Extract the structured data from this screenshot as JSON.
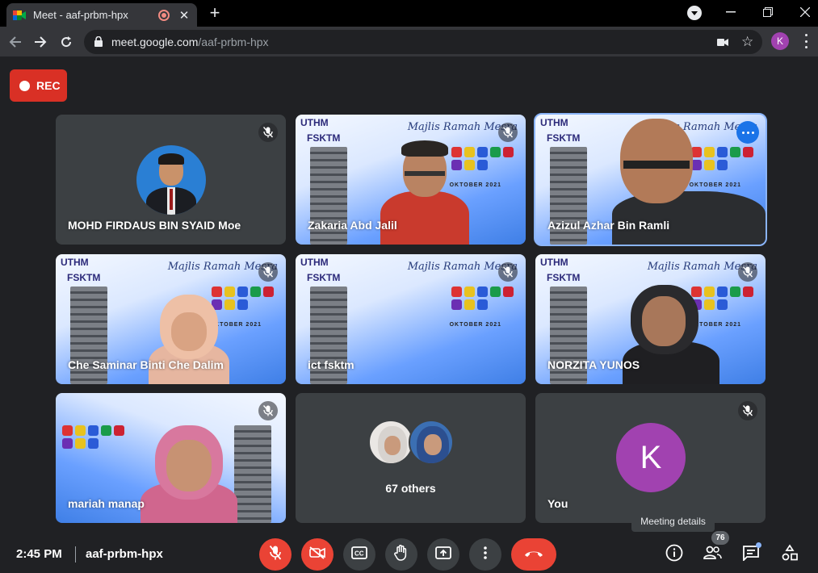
{
  "browser": {
    "tab_title": "Meet - aaf-prbm-hpx",
    "url_host": "meet.google.com",
    "url_path": "/aaf-prbm-hpx",
    "profile_initial": "K",
    "profile_color": "#a142b0"
  },
  "recording": {
    "label": "REC"
  },
  "tiles": [
    {
      "name": "MOHD FIRDAUS BIN SYAID Moe",
      "muted": true,
      "kind": "avatar"
    },
    {
      "name": "Zakaria Abd Jalil",
      "muted": true,
      "kind": "video"
    },
    {
      "name": "Azizul Azhar Bin Ramli",
      "muted": false,
      "kind": "video",
      "active": true
    },
    {
      "name": "Che Saminar Binti Che Dalim",
      "muted": true,
      "kind": "video"
    },
    {
      "name": "ict fsktm",
      "muted": true,
      "kind": "video"
    },
    {
      "name": "NORZITA YUNOS",
      "muted": true,
      "kind": "video"
    },
    {
      "name": "mariah manap",
      "muted": true,
      "kind": "video"
    },
    {
      "name": "67 others",
      "muted": false,
      "kind": "others"
    },
    {
      "name": "You",
      "muted": true,
      "kind": "self",
      "initial": "K"
    }
  ],
  "poster": {
    "logo_top": "UTHM",
    "logo_bottom": "FSKTM",
    "script_title": "Majlis Ramah Mesra",
    "date": "OKTOBER 2021"
  },
  "tooltip": "Meeting details",
  "bottom_bar": {
    "time": "2:45 PM",
    "meeting_code": "aaf-prbm-hpx",
    "participants_count": "76"
  },
  "colors": {
    "accent_blue": "#8ab4f8",
    "danger_red": "#ea4335",
    "rec_red": "#d93025",
    "tile_bg": "#3c4043"
  }
}
